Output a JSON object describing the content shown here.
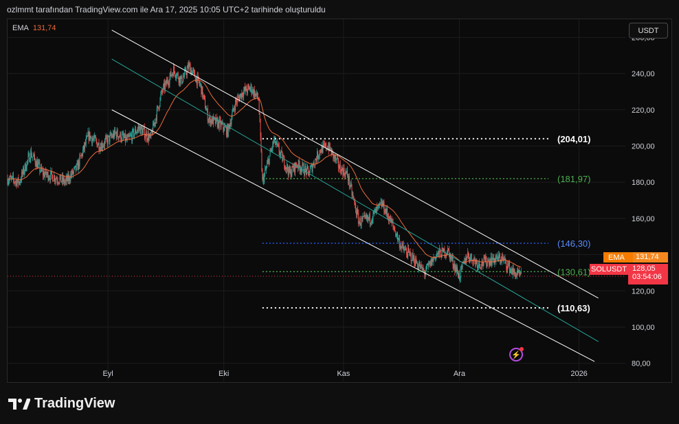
{
  "header": {
    "attribution": "ozlmmt tarafından TradingView.com ile Ara 17, 2025 10:05 UTC+2 tarihinde oluşturuldu"
  },
  "indicator": {
    "name": "EMA",
    "value": "131,74"
  },
  "currency": "USDT",
  "price_tags": {
    "ema": {
      "label": "EMA",
      "value": "131,74"
    },
    "symbol": {
      "label": "SOLUSDT",
      "value": "128,05",
      "countdown": "03:54:06"
    }
  },
  "brand": {
    "name": "TradingView"
  },
  "colors": {
    "up": "#26a69a",
    "down": "#ef5350",
    "ema": "#f06b3d",
    "channel": "#ffffff",
    "midline": "#26a69a",
    "blue": "#2962ff",
    "green": "#4caf50",
    "tag_red": "#f23645",
    "tag_orange": "#f57c00"
  },
  "chart_data": {
    "type": "candlestick",
    "symbol": "SOLUSDT",
    "ylim": [
      70,
      270
    ],
    "y_ticks": [
      {
        "value": 80,
        "label": "80,00"
      },
      {
        "value": 100,
        "label": "100,00"
      },
      {
        "value": 120,
        "label": "120,00"
      },
      {
        "value": 140,
        "label": "140,00"
      },
      {
        "value": 160,
        "label": "160,00"
      },
      {
        "value": 180,
        "label": "180,00"
      },
      {
        "value": 200,
        "label": "200,00"
      },
      {
        "value": 220,
        "label": "220,00"
      },
      {
        "value": 240,
        "label": "240,00"
      },
      {
        "value": 260,
        "label": "260,00"
      }
    ],
    "x_range": [
      "2025-08-06",
      "2026-01-13"
    ],
    "x_ticks": [
      {
        "date": "2025-09-01",
        "label": "Eyl"
      },
      {
        "date": "2025-10-01",
        "label": "Eki"
      },
      {
        "date": "2025-11-01",
        "label": "Kas"
      },
      {
        "date": "2025-12-01",
        "label": "Ara"
      },
      {
        "date": "2026-01-01",
        "label": "2026"
      }
    ],
    "price_path": [
      [
        "2025-08-06",
        182
      ],
      [
        "2025-08-09",
        180
      ],
      [
        "2025-08-12",
        196
      ],
      [
        "2025-08-15",
        185
      ],
      [
        "2025-08-18",
        183
      ],
      [
        "2025-08-21",
        180
      ],
      [
        "2025-08-24",
        188
      ],
      [
        "2025-08-27",
        206
      ],
      [
        "2025-08-30",
        200
      ],
      [
        "2025-09-03",
        207
      ],
      [
        "2025-09-06",
        203
      ],
      [
        "2025-09-09",
        210
      ],
      [
        "2025-09-12",
        204
      ],
      [
        "2025-09-15",
        230
      ],
      [
        "2025-09-18",
        242
      ],
      [
        "2025-09-20",
        236
      ],
      [
        "2025-09-22",
        244
      ],
      [
        "2025-09-25",
        233
      ],
      [
        "2025-09-27",
        215
      ],
      [
        "2025-09-30",
        212
      ],
      [
        "2025-10-02",
        208
      ],
      [
        "2025-10-04",
        224
      ],
      [
        "2025-10-06",
        230
      ],
      [
        "2025-10-08",
        232
      ],
      [
        "2025-10-10",
        226
      ],
      [
        "2025-10-11",
        180
      ],
      [
        "2025-10-14",
        203
      ],
      [
        "2025-10-16",
        194
      ],
      [
        "2025-10-18",
        185
      ],
      [
        "2025-10-20",
        190
      ],
      [
        "2025-10-23",
        185
      ],
      [
        "2025-10-26",
        198
      ],
      [
        "2025-10-28",
        200
      ],
      [
        "2025-10-31",
        188
      ],
      [
        "2025-11-02",
        184
      ],
      [
        "2025-11-05",
        158
      ],
      [
        "2025-11-08",
        160
      ],
      [
        "2025-11-11",
        168
      ],
      [
        "2025-11-14",
        155
      ],
      [
        "2025-11-16",
        144
      ],
      [
        "2025-11-19",
        138
      ],
      [
        "2025-11-22",
        130
      ],
      [
        "2025-11-25",
        140
      ],
      [
        "2025-11-28",
        142
      ],
      [
        "2025-12-01",
        128
      ],
      [
        "2025-12-03",
        140
      ],
      [
        "2025-12-06",
        135
      ],
      [
        "2025-12-09",
        137
      ],
      [
        "2025-12-12",
        138
      ],
      [
        "2025-12-15",
        130
      ],
      [
        "2025-12-17",
        128
      ]
    ],
    "ema": {
      "name": "EMA",
      "last": 131.74
    },
    "last_price": 128.05,
    "levels": [
      {
        "value": 204.01,
        "label": "(204,01)",
        "style": "white-dotted",
        "from": "2025-10-11"
      },
      {
        "value": 181.97,
        "label": "(181,97)",
        "style": "green-dotted",
        "from": "2025-10-11"
      },
      {
        "value": 146.3,
        "label": "(146,30)",
        "style": "blue-dotted",
        "from": "2025-10-11"
      },
      {
        "value": 130.61,
        "label": "(130,61)",
        "style": "green-dotted",
        "from": "2025-10-11"
      },
      {
        "value": 110.63,
        "label": "(110,63)",
        "style": "white-dotted",
        "from": "2025-10-11"
      }
    ],
    "channel": {
      "upper": [
        [
          "2025-09-02",
          264
        ],
        [
          "2026-01-06",
          116
        ]
      ],
      "middle": [
        [
          "2025-09-02",
          248
        ],
        [
          "2026-01-06",
          92
        ]
      ],
      "lower": [
        [
          "2025-09-02",
          220
        ],
        [
          "2026-01-05",
          81
        ]
      ]
    },
    "grid": true
  }
}
